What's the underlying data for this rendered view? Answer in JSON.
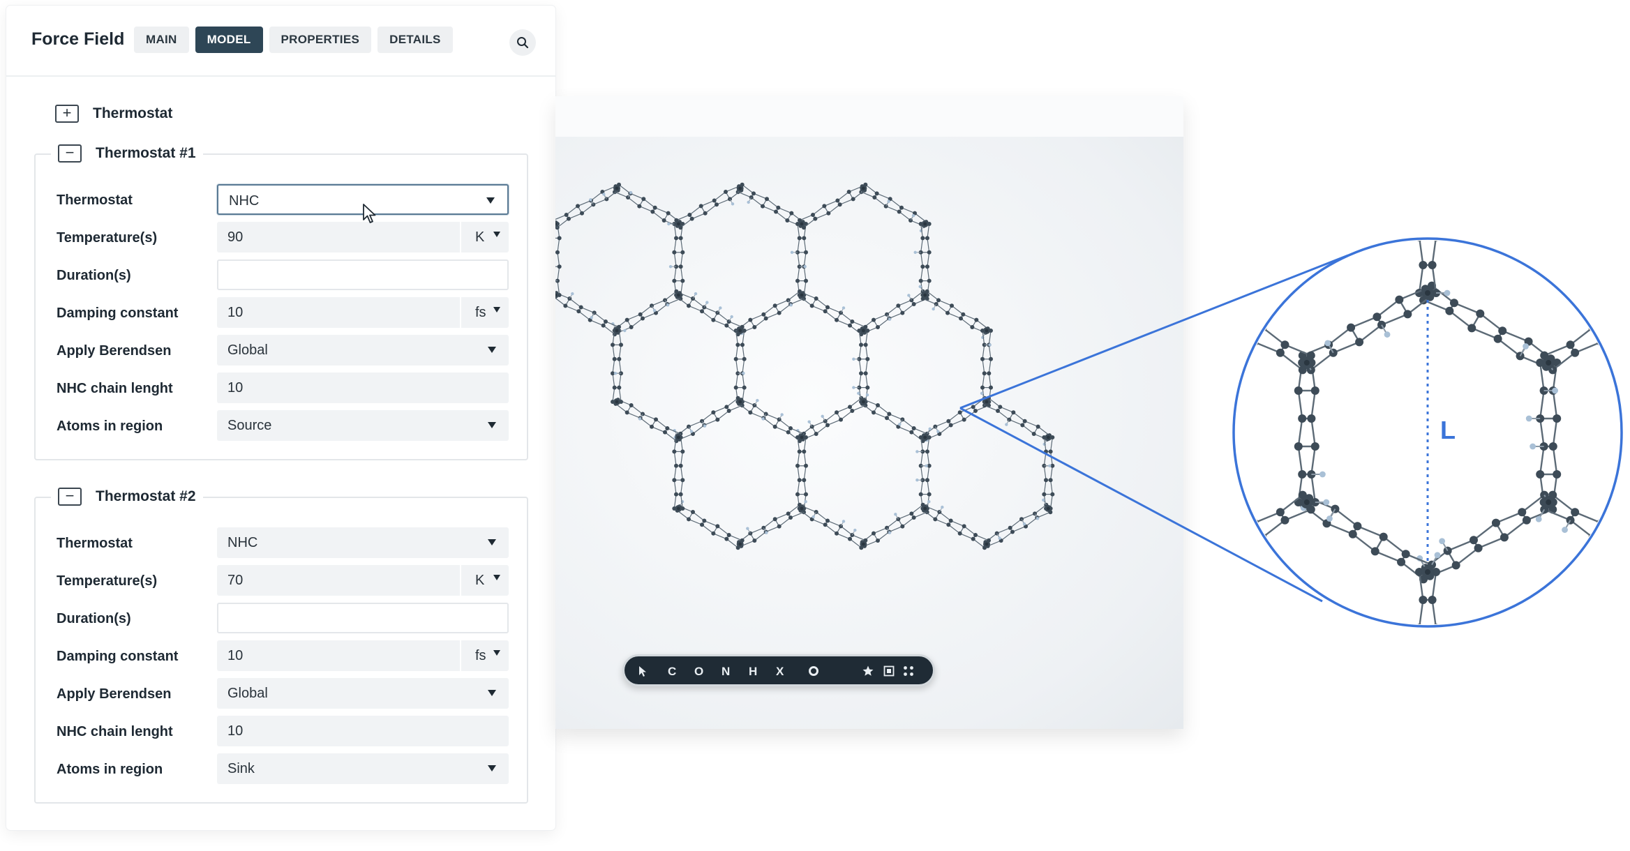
{
  "panel": {
    "title": "Force Field",
    "tabs": [
      {
        "label": "MAIN",
        "active": false
      },
      {
        "label": "MODEL",
        "active": true
      },
      {
        "label": "PROPERTIES",
        "active": false
      },
      {
        "label": "DETAILS",
        "active": false
      }
    ],
    "add_thermostat": {
      "icon": "plus-icon",
      "label": "Thermostat"
    },
    "groups": [
      {
        "title": "Thermostat #1",
        "fields": [
          {
            "label": "Thermostat",
            "value": "NHC",
            "type": "select"
          },
          {
            "label": "Temperature(s)",
            "value": "90",
            "unit": "K",
            "type": "unit"
          },
          {
            "label": "Duration(s)",
            "value": "",
            "type": "text"
          },
          {
            "label": "Damping constant",
            "value": "10",
            "unit": "fs",
            "type": "unit"
          },
          {
            "label": "Apply Berendsen",
            "value": "Global",
            "type": "select"
          },
          {
            "label": "NHC chain lenght",
            "value": "10",
            "type": "text"
          },
          {
            "label": "Atoms in region",
            "value": "Source",
            "type": "select"
          }
        ]
      },
      {
        "title": "Thermostat #2",
        "fields": [
          {
            "label": "Thermostat",
            "value": "NHC",
            "type": "select"
          },
          {
            "label": "Temperature(s)",
            "value": "70",
            "unit": "K",
            "type": "unit"
          },
          {
            "label": "Duration(s)",
            "value": "",
            "type": "text"
          },
          {
            "label": "Damping constant",
            "value": "10",
            "unit": "fs",
            "type": "unit"
          },
          {
            "label": "Apply Berendsen",
            "value": "Global",
            "type": "select"
          },
          {
            "label": "NHC chain lenght",
            "value": "10",
            "type": "text"
          },
          {
            "label": "Atoms in region",
            "value": "Sink",
            "type": "select"
          }
        ]
      }
    ]
  },
  "viewer": {
    "toolbar": {
      "items": [
        {
          "kind": "icon",
          "icon": "pointer-icon"
        },
        {
          "kind": "text",
          "label": "C"
        },
        {
          "kind": "text",
          "label": "O"
        },
        {
          "kind": "text",
          "label": "N"
        },
        {
          "kind": "text",
          "label": "H"
        },
        {
          "kind": "text",
          "label": "X"
        },
        {
          "kind": "icon",
          "icon": "ring-icon"
        },
        {
          "kind": "icon",
          "icon": "star-icon"
        },
        {
          "kind": "icon",
          "icon": "frame-icon"
        },
        {
          "kind": "icon",
          "icon": "grid-dots-icon"
        }
      ]
    },
    "zoom_label": "L"
  },
  "colors": {
    "accent_tab": "#2e4656",
    "zoom_line": "#3b74d9",
    "atom_dark": "#3d4b57",
    "atom_light": "#a9c0d6"
  }
}
